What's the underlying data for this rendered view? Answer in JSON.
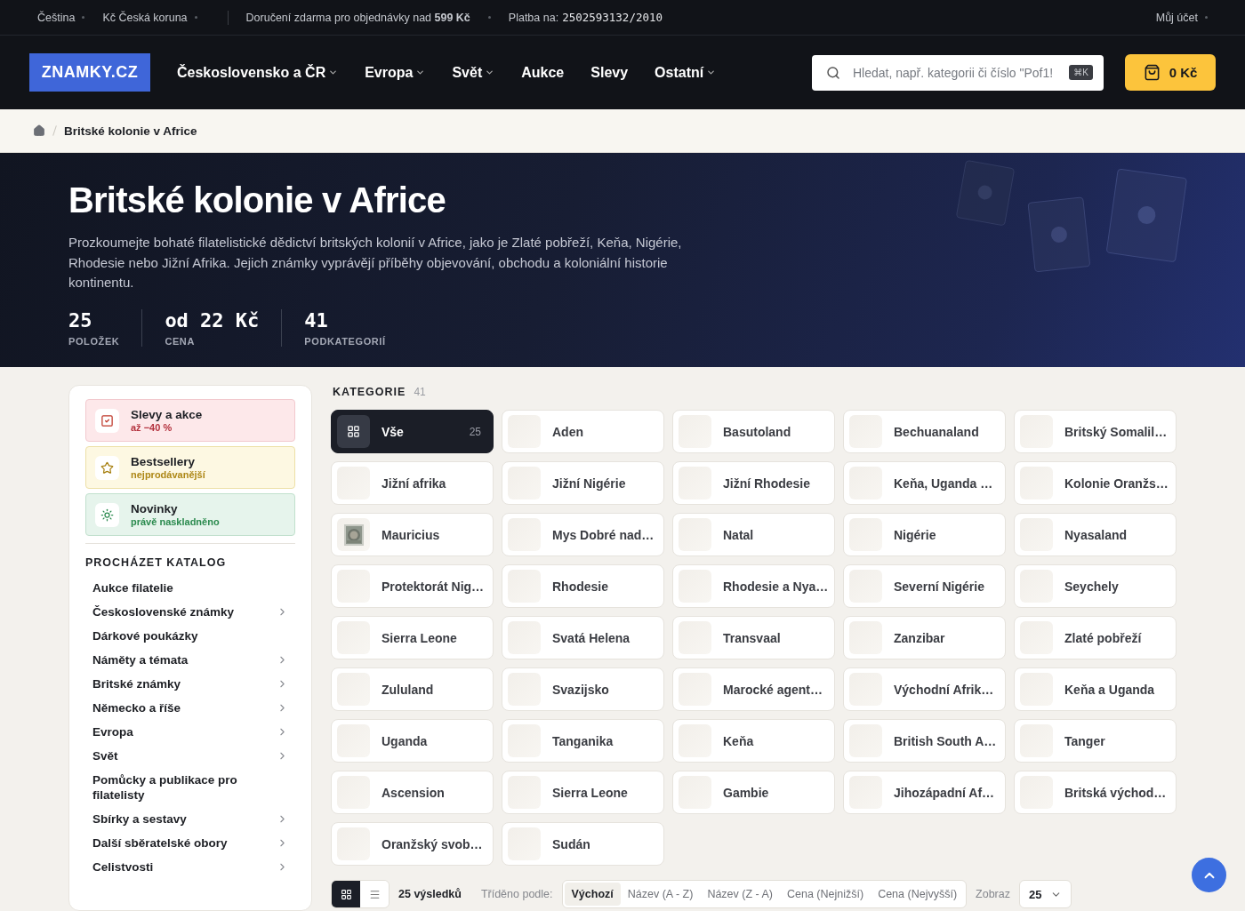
{
  "topbar": {
    "language": "Čeština",
    "currency": "Kč Česká koruna",
    "shipping": "Doručení zdarma pro objednávky nad **599 Kč**",
    "payment_label": "Platba na:",
    "payment_account": "2502593132/2010",
    "account": "Můj účet"
  },
  "nav": {
    "logo": "ZNAMKY.CZ",
    "items": [
      {
        "label": "Československo a ČR",
        "dropdown": true
      },
      {
        "label": "Evropa",
        "dropdown": true
      },
      {
        "label": "Svět",
        "dropdown": true
      },
      {
        "label": "Aukce",
        "dropdown": false
      },
      {
        "label": "Slevy",
        "dropdown": false
      },
      {
        "label": "Ostatní",
        "dropdown": true
      }
    ],
    "search": {
      "placeholder": "Hledat, např. kategorii či číslo \"Pof1!",
      "shortcut": "⌘K"
    },
    "cart": "0 Kč"
  },
  "breadcrumb": [
    "Britské kolonie v Africe"
  ],
  "hero": {
    "title": "Britské kolonie v Africe",
    "description": "Prozkoumejte bohaté filatelistické dědictví britských kolonií v Africe, jako je Zlaté pobřeží, Keňa, Nigérie, Rhodesie nebo Jižní Afrika. Jejich známky vyprávějí příběhy objevování, obchodu a koloniální historie kontinentu.",
    "stats": [
      {
        "value": "25",
        "label": "POLOŽEK"
      },
      {
        "value": "od 22 Kč",
        "label": "CENA"
      },
      {
        "value": "41",
        "label": "PODKATEGORIÍ"
      }
    ]
  },
  "sidebar": {
    "promos": [
      {
        "kind": "sale",
        "title": "Slevy a akce",
        "subtitle": "až −40 %"
      },
      {
        "kind": "best",
        "title": "Bestsellery",
        "subtitle": "nejprodávanější"
      },
      {
        "kind": "new",
        "title": "Novinky",
        "subtitle": "právě naskladněno"
      }
    ],
    "catalog_title": "PROCHÁZET KATALOG",
    "catalog": [
      {
        "label": "Aukce filatelie",
        "has_children": false
      },
      {
        "label": "Československé známky",
        "has_children": true
      },
      {
        "label": "Dárkové poukázky",
        "has_children": false
      },
      {
        "label": "Náměty a témata",
        "has_children": true
      },
      {
        "label": "Britské známky",
        "has_children": true
      },
      {
        "label": "Německo a říše",
        "has_children": true
      },
      {
        "label": "Evropa",
        "has_children": true
      },
      {
        "label": "Svět",
        "has_children": true
      },
      {
        "label": "Pomůcky a publikace pro filatelisty",
        "has_children": false
      },
      {
        "label": "Sbírky a sestavy",
        "has_children": true
      },
      {
        "label": "Další sběratelské obory",
        "has_children": true
      },
      {
        "label": "Celistvosti",
        "has_children": true
      }
    ]
  },
  "categories": {
    "title": "KATEGORIE",
    "count": "41",
    "items": [
      {
        "kind": "all",
        "label": "Vše",
        "count": "25",
        "selected": true
      },
      {
        "kind": "category",
        "label": "Aden",
        "selected": false
      },
      {
        "kind": "category",
        "label": "Basutoland",
        "selected": false
      },
      {
        "kind": "category",
        "label": "Bechuanaland",
        "selected": false
      },
      {
        "kind": "category",
        "label": "Britský Somalil…",
        "selected": false
      },
      {
        "kind": "category",
        "label": "Jižní afrika",
        "selected": false
      },
      {
        "kind": "category",
        "label": "Jižní Nigérie",
        "selected": false
      },
      {
        "kind": "category",
        "label": "Jižní Rhodesie",
        "selected": false
      },
      {
        "kind": "category",
        "label": "Keňa, Uganda …",
        "selected": false
      },
      {
        "kind": "category",
        "label": "Kolonie Oranžs…",
        "selected": false
      },
      {
        "kind": "category",
        "label": "Mauricius",
        "selected": false,
        "has_image": true
      },
      {
        "kind": "category",
        "label": "Mys Dobré nad…",
        "selected": false
      },
      {
        "kind": "category",
        "label": "Natal",
        "selected": false
      },
      {
        "kind": "category",
        "label": "Nigérie",
        "selected": false
      },
      {
        "kind": "category",
        "label": "Nyasaland",
        "selected": false
      },
      {
        "kind": "category",
        "label": "Protektorát Nig…",
        "selected": false
      },
      {
        "kind": "category",
        "label": "Rhodesie",
        "selected": false
      },
      {
        "kind": "category",
        "label": "Rhodesie a Nya…",
        "selected": false
      },
      {
        "kind": "category",
        "label": "Severní Nigérie",
        "selected": false
      },
      {
        "kind": "category",
        "label": "Seychely",
        "selected": false
      },
      {
        "kind": "category",
        "label": "Sierra Leone",
        "selected": false
      },
      {
        "kind": "category",
        "label": "Svatá Helena",
        "selected": false
      },
      {
        "kind": "category",
        "label": "Transvaal",
        "selected": false
      },
      {
        "kind": "category",
        "label": "Zanzibar",
        "selected": false
      },
      {
        "kind": "category",
        "label": "Zlaté pobřeží",
        "selected": false
      },
      {
        "kind": "category",
        "label": "Zululand",
        "selected": false
      },
      {
        "kind": "category",
        "label": "Svazijsko",
        "selected": false
      },
      {
        "kind": "category",
        "label": "Marocké agent…",
        "selected": false
      },
      {
        "kind": "category",
        "label": "Východní Afrik…",
        "selected": false
      },
      {
        "kind": "category",
        "label": "Keňa a Uganda",
        "selected": false
      },
      {
        "kind": "category",
        "label": "Uganda",
        "selected": false
      },
      {
        "kind": "category",
        "label": "Tanganika",
        "selected": false
      },
      {
        "kind": "category",
        "label": "Keňa",
        "selected": false
      },
      {
        "kind": "category",
        "label": "British South A…",
        "selected": false
      },
      {
        "kind": "category",
        "label": "Tanger",
        "selected": false
      },
      {
        "kind": "category",
        "label": "Ascension",
        "selected": false
      },
      {
        "kind": "category",
        "label": "Sierra Leone",
        "selected": false
      },
      {
        "kind": "category",
        "label": "Gambie",
        "selected": false
      },
      {
        "kind": "category",
        "label": "Jihozápadní Af…",
        "selected": false
      },
      {
        "kind": "category",
        "label": "Britská východ…",
        "selected": false
      },
      {
        "kind": "category",
        "label": "Oranžský svob…",
        "selected": false
      },
      {
        "kind": "category",
        "label": "Sudán",
        "selected": false
      }
    ]
  },
  "toolbar": {
    "views": [
      {
        "kind": "grid",
        "selected": true
      },
      {
        "kind": "list",
        "selected": false
      }
    ],
    "results": "25 výsledků",
    "sort_label": "Tříděno podle:",
    "sort_options": [
      {
        "label": "Výchozí",
        "selected": true
      },
      {
        "label": "Název (A - Z)",
        "selected": false
      },
      {
        "label": "Název (Z - A)",
        "selected": false
      },
      {
        "label": "Cena (Nejnižší)",
        "selected": false
      },
      {
        "label": "Cena (Nejvyšší)",
        "selected": false
      }
    ],
    "per_page_label": "Zobraz",
    "per_page": "25"
  }
}
